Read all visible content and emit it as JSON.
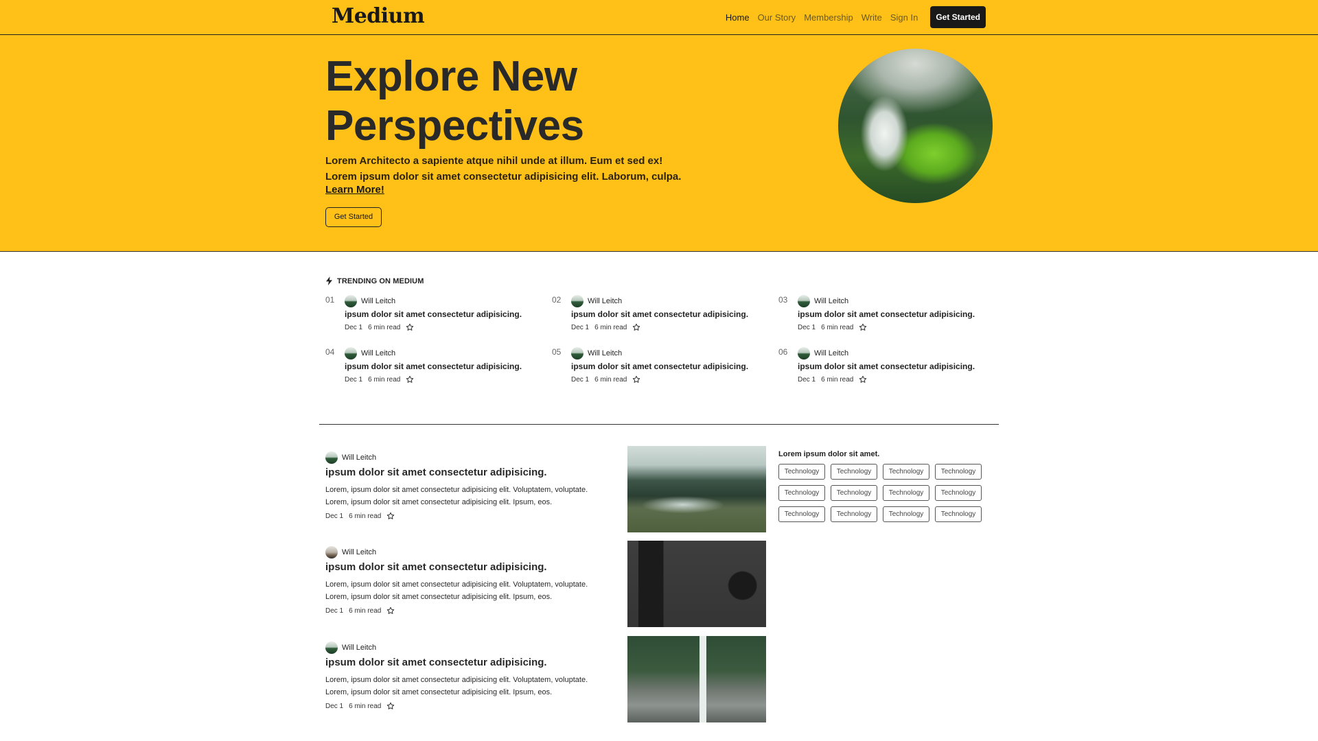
{
  "header": {
    "logo": "Medium",
    "nav": [
      "Home",
      "Our Story",
      "Membership",
      "Write",
      "Sign In"
    ],
    "cta": "Get Started"
  },
  "hero": {
    "title": "Explore New Perspectives",
    "text_line1": "Lorem Architecto a sapiente atque nihil unde at illum. Eum et sed ex!",
    "text_line2": "Lorem ipsum dolor sit amet consectetur adipisicing elit. Laborum, culpa.",
    "link": "Learn More!",
    "button": "Get Started",
    "image_icon": "waterfall-photo"
  },
  "trending": {
    "heading": "TRENDING ON MEDIUM",
    "icon": "lightning-icon",
    "items": [
      {
        "num": "01",
        "author": "Will Leitch",
        "title": "ipsum dolor sit amet consectetur adipisicing.",
        "date": "Dec 1",
        "read": "6 min read"
      },
      {
        "num": "02",
        "author": "Will Leitch",
        "title": "ipsum dolor sit amet consectetur adipisicing.",
        "date": "Dec 1",
        "read": "6 min read"
      },
      {
        "num": "03",
        "author": "Will Leitch",
        "title": "ipsum dolor sit amet consectetur adipisicing.",
        "date": "Dec 1",
        "read": "6 min read"
      },
      {
        "num": "04",
        "author": "Will Leitch",
        "title": "ipsum dolor sit amet consectetur adipisicing.",
        "date": "Dec 1",
        "read": "6 min read"
      },
      {
        "num": "05",
        "author": "Will Leitch",
        "title": "ipsum dolor sit amet consectetur adipisicing.",
        "date": "Dec 1",
        "read": "6 min read"
      },
      {
        "num": "06",
        "author": "Will Leitch",
        "title": "ipsum dolor sit amet consectetur adipisicing.",
        "date": "Dec 1",
        "read": "6 min read"
      }
    ]
  },
  "articles": [
    {
      "author": "Will Leitch",
      "title": "ipsum dolor sit amet consectetur adipisicing.",
      "desc_line1": "Lorem, ipsum dolor sit amet consectetur adipisicing elit. Voluptatem, voluptate.",
      "desc_line2": "Lorem, ipsum dolor sit amet consectetur adipisicing elit. Ipsum, eos.",
      "date": "Dec 1",
      "read": "6 min read",
      "image": "forest-river-photo"
    },
    {
      "author": "Will Leitch",
      "title": "ipsum dolor sit amet consectetur adipisicing.",
      "desc_line1": "Lorem, ipsum dolor sit amet consectetur adipisicing elit. Voluptatem, voluptate.",
      "desc_line2": "Lorem, ipsum dolor sit amet consectetur adipisicing elit. Ipsum, eos.",
      "date": "Dec 1",
      "read": "6 min read",
      "image": "flatlay-gadgets-photo"
    },
    {
      "author": "Will Leitch",
      "title": "ipsum dolor sit amet consectetur adipisicing.",
      "desc_line1": "Lorem, ipsum dolor sit amet consectetur adipisicing elit. Voluptatem, voluptate.",
      "desc_line2": "Lorem, ipsum dolor sit amet consectetur adipisicing elit. Ipsum, eos.",
      "date": "Dec 1",
      "read": "6 min read",
      "image": "waterfall-rocks-photo"
    }
  ],
  "sidebar": {
    "title": "Lorem ipsum dolor sit amet.",
    "tags": [
      "Technology",
      "Technology",
      "Technology",
      "Technology",
      "Technology",
      "Technology",
      "Technology",
      "Technology",
      "Technology",
      "Technology",
      "Technology",
      "Technology"
    ]
  },
  "colors": {
    "brand": "#ffc017",
    "dark": "#191919"
  }
}
